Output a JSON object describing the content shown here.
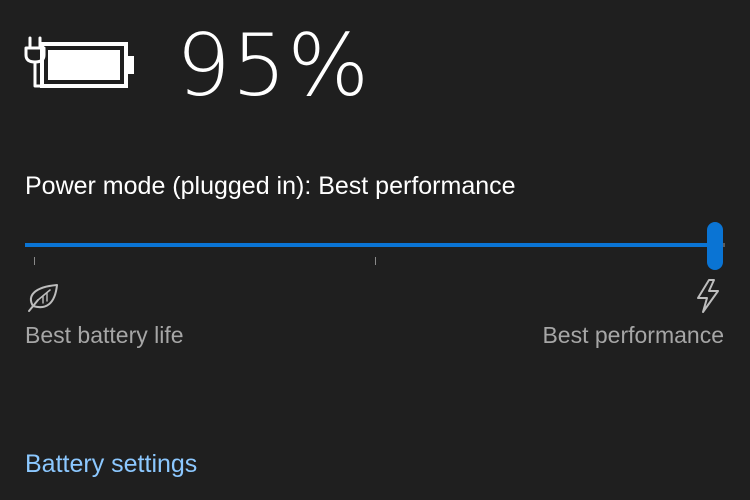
{
  "battery": {
    "percent_text": "95%",
    "charging": true,
    "icon": "battery-charging-icon"
  },
  "power_mode": {
    "label": "Power mode (plugged in): Best performance",
    "slider_value": 1.0,
    "min_label": "Best battery life",
    "max_label": "Best performance",
    "min_icon": "leaf-icon",
    "max_icon": "lightning-bolt-icon"
  },
  "battery_settings_link": "Battery settings",
  "colors": {
    "background": "#1f1f1f",
    "accent": "#0a74d4",
    "link": "#8cc8ff",
    "track": "#5a5a5a",
    "secondary_text": "#a6a6a6"
  }
}
